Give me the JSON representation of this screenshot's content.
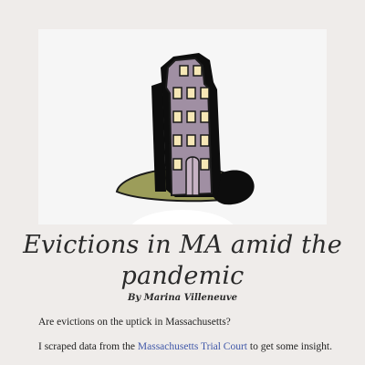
{
  "hero": {
    "image": "building-illustration"
  },
  "article": {
    "title": "Evictions in MA amid the pandemic",
    "byline": "By Marina Villeneuve",
    "intro_1": "Are evictions on the uptick in Massachusetts?",
    "intro_2_before": "I scraped data from the ",
    "intro_2_link": "Massachusetts Trial Court",
    "intro_2_after": " to get some insight."
  },
  "colors": {
    "background": "#efecea",
    "building": "#a08fa3",
    "window": "#f6e7b6",
    "ground": "#9c9d5a",
    "link": "#3f57a8"
  }
}
